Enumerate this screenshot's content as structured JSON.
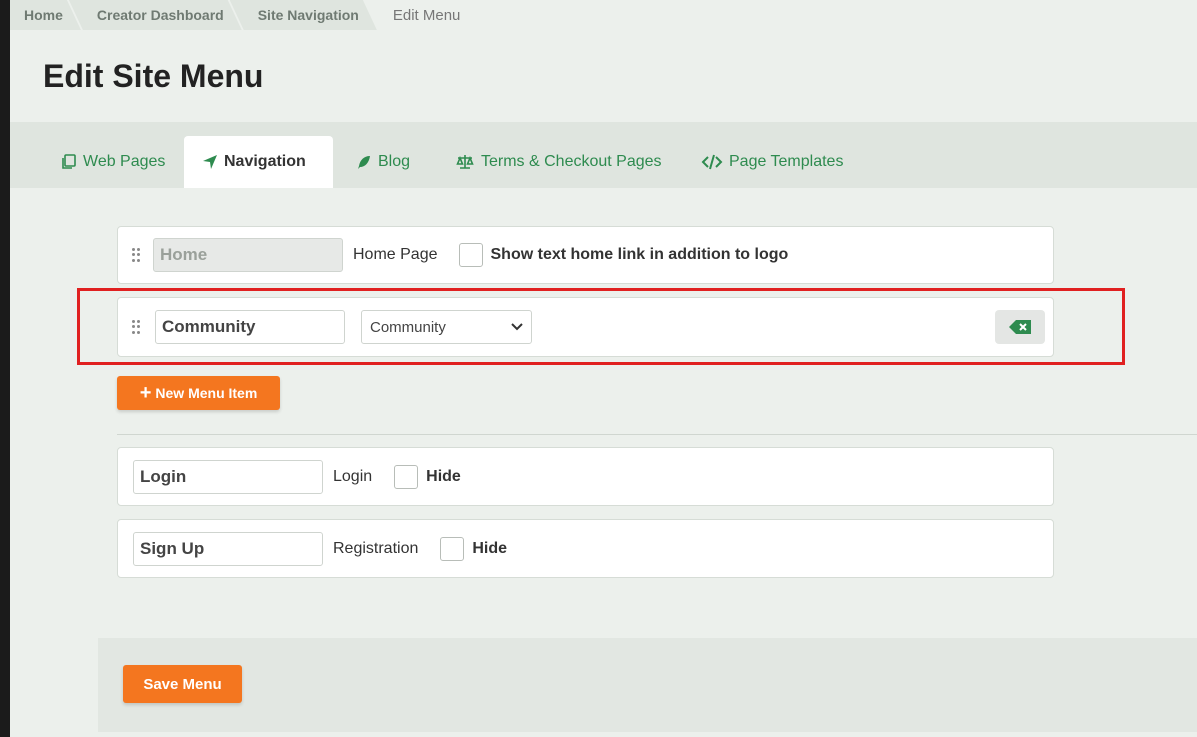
{
  "breadcrumb": [
    "Home",
    "Creator Dashboard",
    "Site Navigation",
    "Edit Menu"
  ],
  "page_title": "Edit Site Menu",
  "tabs": [
    {
      "label": "Web Pages",
      "icon": "copy-icon"
    },
    {
      "label": "Navigation",
      "icon": "location-arrow-icon"
    },
    {
      "label": "Blog",
      "icon": "feather-icon"
    },
    {
      "label": "Terms & Checkout Pages",
      "icon": "balance-scale-icon"
    },
    {
      "label": "Page Templates",
      "icon": "code-icon"
    }
  ],
  "menu_items": {
    "home": {
      "value": "Home",
      "page": "Home Page",
      "checkbox_label": "Show text home link in addition to logo"
    },
    "community": {
      "value": "Community",
      "selected": "Community"
    }
  },
  "new_item_label": "New Menu Item",
  "auth_items": {
    "login": {
      "value": "Login",
      "page": "Login",
      "checkbox_label": "Hide"
    },
    "signup": {
      "value": "Sign Up",
      "page": "Registration",
      "checkbox_label": "Hide"
    }
  },
  "save_label": "Save Menu",
  "colors": {
    "accent_green": "#2e8b4f",
    "button_orange": "#f4761f",
    "highlight_red": "#e02020"
  }
}
